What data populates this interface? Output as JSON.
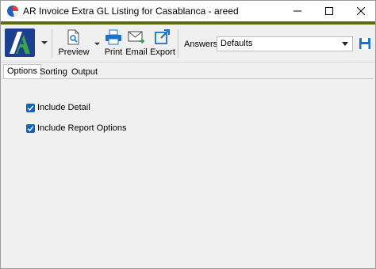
{
  "window": {
    "title": "AR Invoice Extra GL Listing for Casablanca - areed",
    "controls": [
      "minimize",
      "maximize",
      "close"
    ]
  },
  "colors": {
    "accent_bar": "#5f6a10",
    "checkbox": "#0b63c4",
    "toolbar_icon": "#1a73c7"
  },
  "toolbar": {
    "logo": "ar-logo-icon",
    "preview_label": "Preview",
    "print_label": "Print",
    "email_label": "Email",
    "export_label": "Export",
    "answers_label": "Answers:",
    "answers_value": "Defaults",
    "save_icon": "save-icon"
  },
  "tabs": [
    {
      "label": "Options",
      "active": true
    },
    {
      "label": "Sorting",
      "active": false
    },
    {
      "label": "Output",
      "active": false
    }
  ],
  "options": [
    {
      "label": "Include Detail",
      "checked": true
    },
    {
      "label": "Include Report Options",
      "checked": true
    }
  ]
}
